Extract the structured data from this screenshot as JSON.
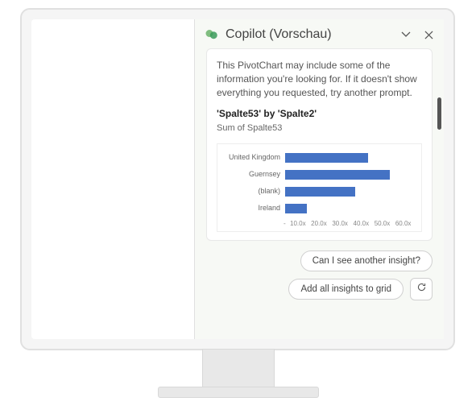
{
  "header": {
    "title": "Copilot (Vorschau)"
  },
  "message": {
    "description": "This PivotChart may include some of the information you're looking for. If it doesn't show everything you requested, try another prompt.",
    "chart_title": "'Spalte53' by 'Spalte2'",
    "chart_subtitle": "Sum of Spalte53"
  },
  "chart_data": {
    "type": "bar",
    "orientation": "horizontal",
    "categories": [
      "United Kingdom",
      "Guernsey",
      "(blank)",
      "Ireland"
    ],
    "values": [
      38,
      48,
      32,
      10
    ],
    "x_ticks": [
      "-",
      "10.0x",
      "20.0x",
      "30.0x",
      "40.0x",
      "50.0x",
      "60.0x"
    ],
    "xlim": [
      0,
      60
    ],
    "bar_color": "#4472c4"
  },
  "suggestions": {
    "s1": "Can I see another insight?",
    "s2": "Add all insights to grid"
  }
}
